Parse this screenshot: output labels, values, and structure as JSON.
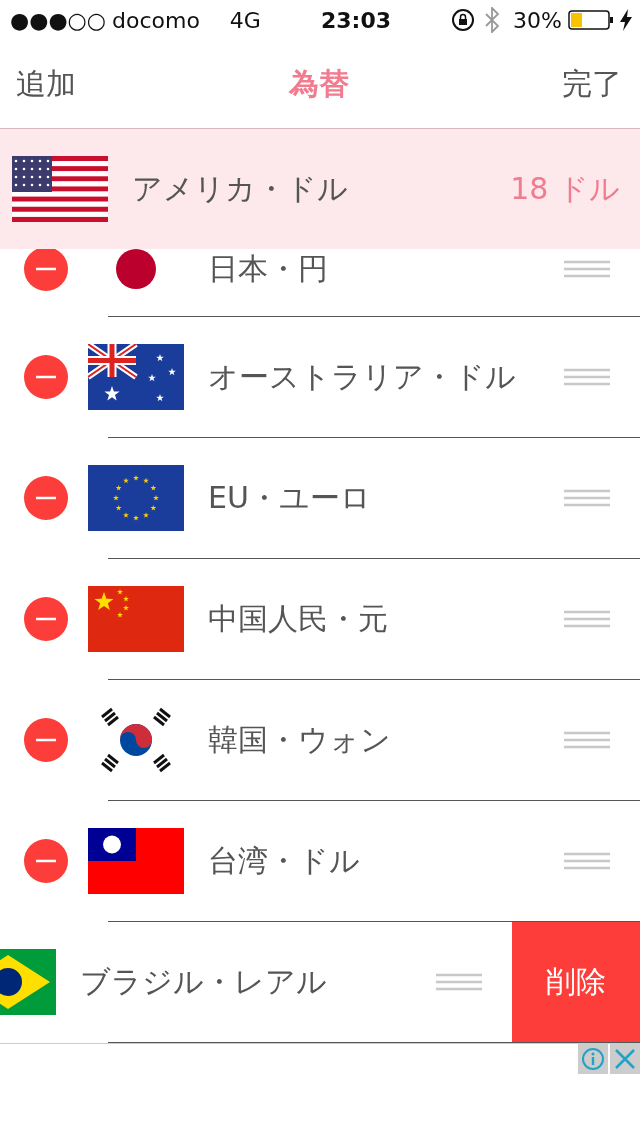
{
  "status_bar": {
    "signal": "●●●○○",
    "carrier": "docomo",
    "network": "4G",
    "time": "23:03",
    "battery": "30%"
  },
  "nav": {
    "left": "追加",
    "title": "為替",
    "right": "完了"
  },
  "base": {
    "kind": "us",
    "name": "アメリカ・ドル",
    "amount": "18 ドル"
  },
  "rows": [
    {
      "kind": "jp",
      "name": "日本・円",
      "partial": true,
      "swiped": false
    },
    {
      "kind": "au",
      "name": "オーストラリア・ドル",
      "partial": false,
      "swiped": false
    },
    {
      "kind": "eu",
      "name": "EU・ユーロ",
      "partial": false,
      "swiped": false
    },
    {
      "kind": "cn",
      "name": "中国人民・元",
      "partial": false,
      "swiped": false
    },
    {
      "kind": "kr",
      "name": "韓国・ウォン",
      "partial": false,
      "swiped": false
    },
    {
      "kind": "tw",
      "name": "台湾・ドル",
      "partial": false,
      "swiped": false
    },
    {
      "kind": "br",
      "name": "ブラジル・レアル",
      "partial": false,
      "swiped": true,
      "action": "削除"
    }
  ]
}
